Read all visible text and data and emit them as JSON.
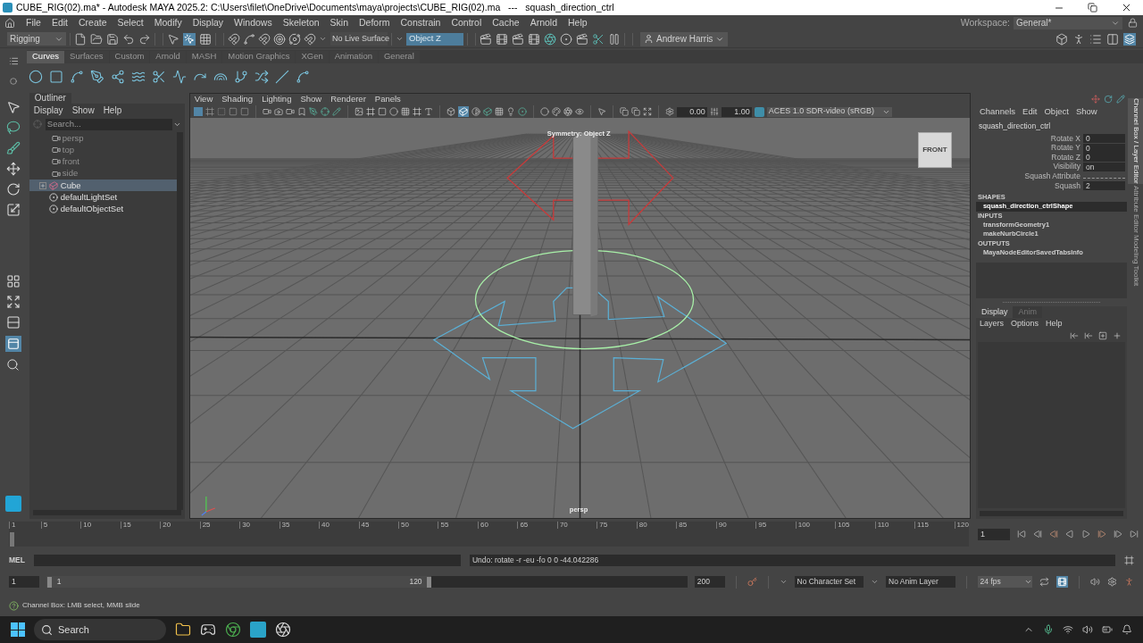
{
  "window": {
    "title": "CUBE_RIG(02).ma* - Autodesk MAYA 2025.2: C:\\Users\\filet\\OneDrive\\Documents\\maya\\projects\\CUBE_RIG(02).ma   ---   squash_direction_ctrl"
  },
  "menu_bar": [
    "File",
    "Edit",
    "Create",
    "Select",
    "Modify",
    "Display",
    "Windows",
    "Skeleton",
    "Skin",
    "Deform",
    "Constrain",
    "Control",
    "Cache",
    "Arnold",
    "Help"
  ],
  "workspace": {
    "label": "Workspace:",
    "value": "General*"
  },
  "status_line": {
    "menu_set": "Rigging",
    "live_surface": "No Live Surface",
    "symmetry": "Object Z",
    "user": "Andrew Harris"
  },
  "shelf": {
    "tabs": [
      {
        "label": "Curves",
        "selected": true
      },
      {
        "label": "Surfaces",
        "selected": false
      },
      {
        "label": "Custom",
        "selected": false
      },
      {
        "label": "Arnold",
        "selected": false
      },
      {
        "label": "MASH",
        "selected": false
      },
      {
        "label": "Motion Graphics",
        "selected": false
      },
      {
        "label": "XGen",
        "selected": false
      },
      {
        "label": "Animation",
        "selected": false
      },
      {
        "label": "General",
        "selected": false
      }
    ]
  },
  "outliner": {
    "title": "Outliner",
    "menus": [
      "Display",
      "Show",
      "Help"
    ],
    "search": {
      "placeholder": "Search..."
    },
    "items": [
      {
        "label": "persp",
        "kind": "camera",
        "hidden": true,
        "selected": false
      },
      {
        "label": "top",
        "kind": "camera",
        "hidden": true,
        "selected": false
      },
      {
        "label": "front",
        "kind": "camera",
        "hidden": true,
        "selected": false
      },
      {
        "label": "side",
        "kind": "camera",
        "hidden": true,
        "selected": false
      },
      {
        "label": "Cube",
        "kind": "transform",
        "hidden": false,
        "selected": true,
        "expanded": false
      },
      {
        "label": "defaultLightSet",
        "kind": "set",
        "hidden": false,
        "selected": false
      },
      {
        "label": "defaultObjectSet",
        "kind": "set",
        "hidden": false,
        "selected": false
      }
    ]
  },
  "viewport": {
    "menus": [
      "View",
      "Shading",
      "Lighting",
      "Show",
      "Renderer",
      "Panels"
    ],
    "exposure": "0.00",
    "gamma": "1.00",
    "color_space": "ACES 1.0 SDR-video (sRGB)",
    "symmetry_label": "Symmetry: Object Z",
    "camera": "persp",
    "view_cube": "FRONT"
  },
  "channel_box": {
    "menus": [
      "Channels",
      "Edit",
      "Object",
      "Show"
    ],
    "node": "squash_direction_ctrl",
    "attributes": [
      {
        "name": "Rotate X",
        "value": "0",
        "kind": "value"
      },
      {
        "name": "Rotate Y",
        "value": "0",
        "kind": "value"
      },
      {
        "name": "Rotate Z",
        "value": "0",
        "kind": "value"
      },
      {
        "name": "Visibility",
        "value": "on",
        "kind": "value"
      },
      {
        "name": "Squash Attribute",
        "kind": "divider"
      },
      {
        "name": "Squash",
        "value": "2",
        "kind": "value"
      }
    ],
    "sections": [
      {
        "heading": "SHAPES",
        "items": [
          {
            "label": "squash_direction_ctrlShape",
            "selected": true
          }
        ]
      },
      {
        "heading": "INPUTS",
        "items": [
          {
            "label": "transformGeometry1",
            "selected": false
          },
          {
            "label": "makeNurbCircle1",
            "selected": false
          }
        ]
      },
      {
        "heading": "OUTPUTS",
        "items": [
          {
            "label": "MayaNodeEditorSavedTabsInfo",
            "selected": false
          }
        ]
      }
    ]
  },
  "layer_editor": {
    "tabs": [
      {
        "label": "Display",
        "selected": true
      },
      {
        "label": "Anim",
        "selected": false
      }
    ],
    "menus": [
      "Layers",
      "Options",
      "Help"
    ]
  },
  "side_tabs": [
    {
      "label": "Channel Box / Layer Editor",
      "selected": true
    },
    {
      "label": "Attribute Editor",
      "selected": false
    },
    {
      "label": "Modeling Toolkit",
      "selected": false
    }
  ],
  "time_slider": {
    "level": 0.0,
    "labels": [
      "1",
      "5",
      "10",
      "15",
      "20",
      "25",
      "30",
      "35",
      "40",
      "45",
      "50",
      "55",
      "60",
      "65",
      "70",
      "75",
      "80",
      "85",
      "90",
      "95",
      "100",
      "105",
      "110",
      "115",
      "120"
    ],
    "current_frame": "1"
  },
  "mel": {
    "label": "MEL",
    "result": "Undo: rotate -r -eu -fo 0 0 -44.042286"
  },
  "range_slider": {
    "level": 0.6,
    "start": "1",
    "range_start": "1",
    "range_end": "120",
    "end": "200",
    "character_set": "No Character Set",
    "anim_layer": "No Anim Layer",
    "fps": "24 fps"
  },
  "help_line": "Channel Box: LMB select, MMB slide",
  "taskbar": {
    "search_placeholder": "Search"
  }
}
